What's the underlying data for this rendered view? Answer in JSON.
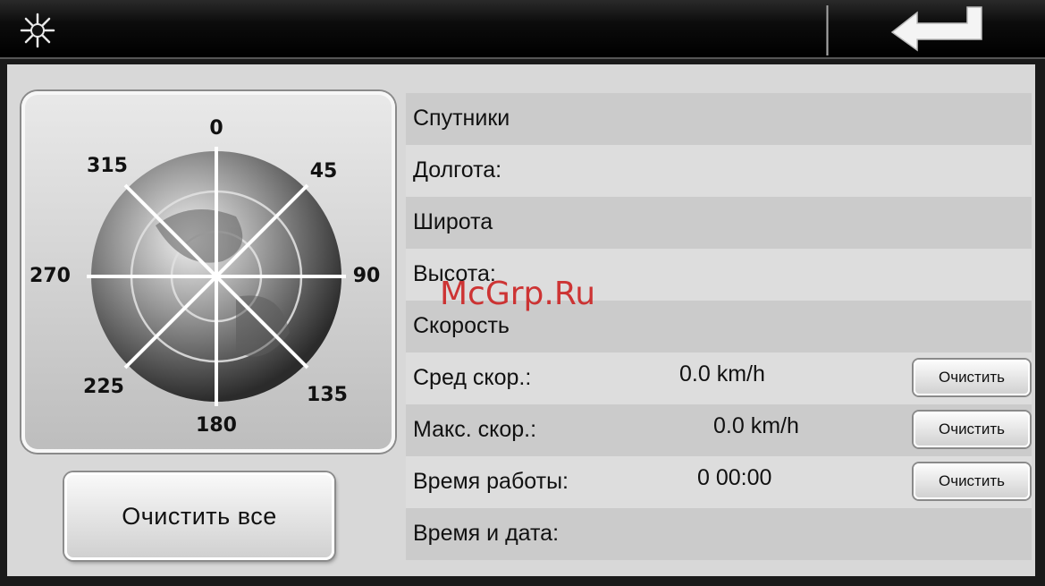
{
  "compass": {
    "n": "0",
    "ne": "45",
    "e": "90",
    "se": "135",
    "s": "180",
    "sw": "225",
    "w": "270",
    "nw": "315"
  },
  "clear_all_label": "Очистить все",
  "rows": [
    {
      "label": "Спутники"
    },
    {
      "label": "Долгота:"
    },
    {
      "label": "Широта"
    },
    {
      "label": "Высота:"
    },
    {
      "label": "Скорость"
    },
    {
      "label": "Сред скор.:",
      "value": "0.0 km/h",
      "button": "Очистить"
    },
    {
      "label": "Макс. скор.:",
      "value": "0.0 km/h",
      "button": "Очистить"
    },
    {
      "label": "Время работы:",
      "value": "0 00:00",
      "button": "Очистить"
    },
    {
      "label": "Время и дата:"
    }
  ],
  "watermark": "McGrp.Ru",
  "icons": {
    "brightness": "sun-icon",
    "back": "back-arrow-icon"
  }
}
